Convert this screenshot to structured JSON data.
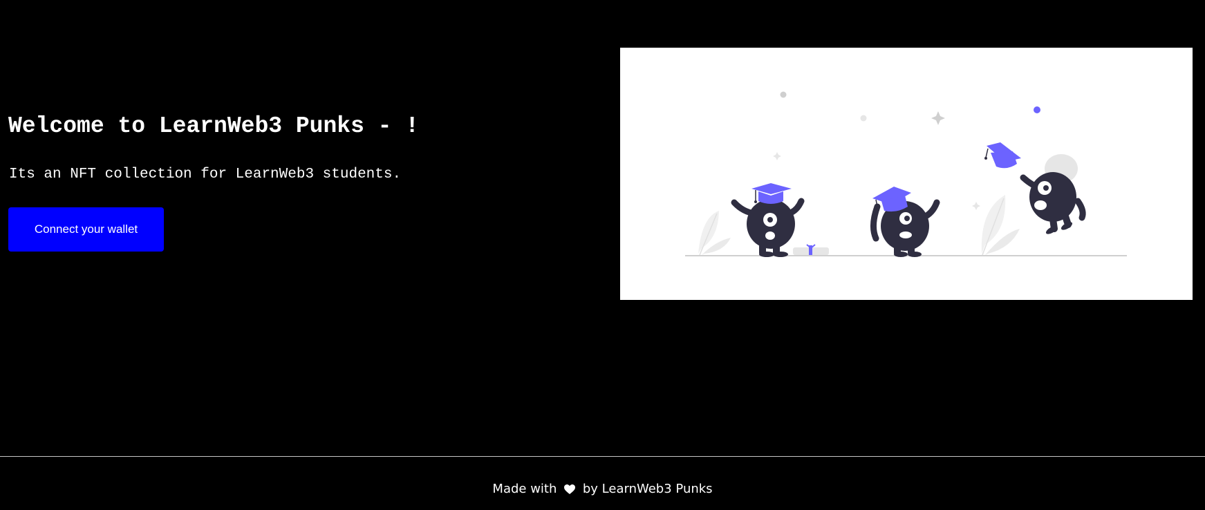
{
  "hero": {
    "title": "Welcome to LearnWeb3 Punks - !",
    "description": "Its an NFT collection for LearnWeb3 students.",
    "connect_button_label": "Connect your wallet",
    "image_alt": "graduation illustration"
  },
  "footer": {
    "made_with": "Made with",
    "heart_icon": "heart-icon",
    "by_text": "by LearnWeb3 Punks"
  },
  "colors": {
    "background": "#000000",
    "button": "#0000ff",
    "accent_purple": "#6c63ff",
    "creature": "#2f2e41"
  }
}
